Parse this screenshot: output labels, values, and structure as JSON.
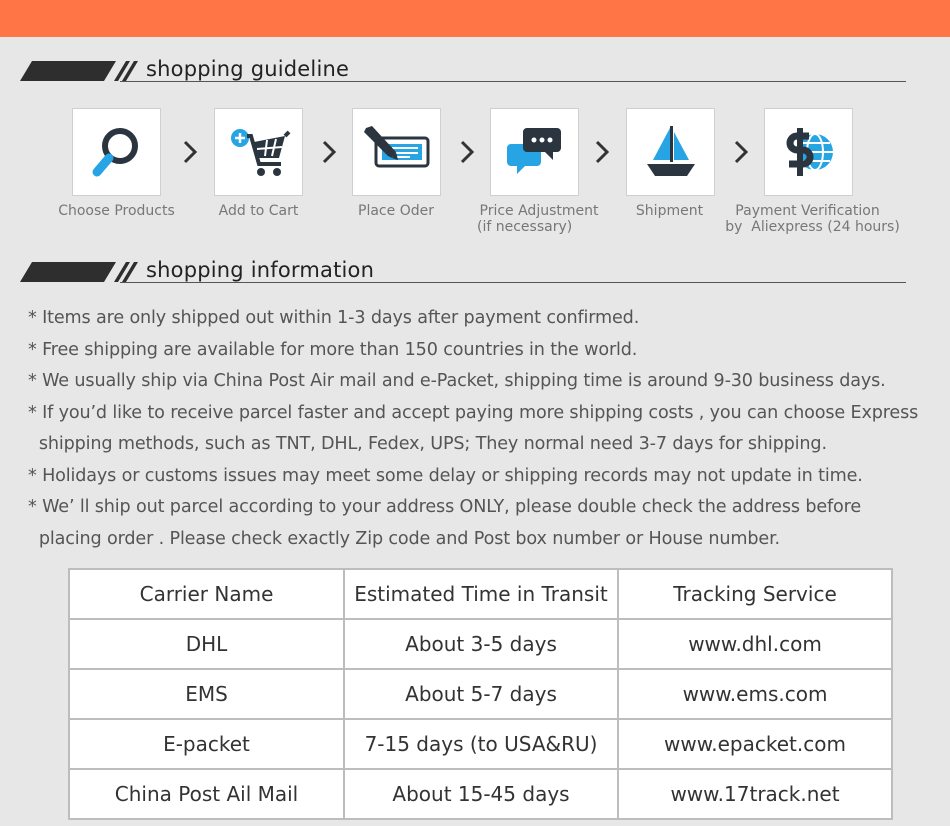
{
  "sections": {
    "guideline_title": "shopping guideline",
    "information_title": "shopping information"
  },
  "steps": [
    {
      "label": "Choose Products",
      "icon": "magnifier-icon"
    },
    {
      "label": "Add to Cart",
      "icon": "shopping-cart-icon"
    },
    {
      "label": "Place Oder",
      "icon": "check-pen-icon"
    },
    {
      "label_line1": "Price Adjustment",
      "label_line2": "(if necessary)",
      "icon": "chat-bubbles-icon"
    },
    {
      "label": "Shipment",
      "icon": "sailboat-icon"
    },
    {
      "label_line1": "Payment Verification",
      "label_line2": "by  Aliexpress (24 hours)",
      "icon": "dollar-globe-icon"
    }
  ],
  "info_items": [
    "* Items are only shipped out within 1-3 days after payment confirmed.",
    "* Free shipping are available for more than 150 countries in the world.",
    "* We usually ship via China Post Air mail and e-Packet, shipping time is around 9-30 business days.",
    "* If you’d like to receive parcel faster and accept paying more shipping costs , you can choose Express",
    "  shipping methods, such as TNT, DHL, Fedex, UPS; They normal need 3-7 days for shipping.",
    "* Holidays or customs issues may meet some delay or shipping records may not update in time.",
    "* We’ ll ship out parcel according to your address ONLY, please double check the address before",
    "  placing order . Please check exactly Zip code and Post box number or House number."
  ],
  "table": {
    "headers": [
      "Carrier Name",
      "Estimated Time in Transit",
      "Tracking Service"
    ],
    "rows": [
      [
        "DHL",
        "About 3-5 days",
        "www.dhl.com"
      ],
      [
        "EMS",
        "About 5-7 days",
        "www.ems.com"
      ],
      [
        "E-packet",
        "7-15 days (to USA&RU)",
        "www.epacket.com"
      ],
      [
        "China Post Ail Mail",
        "About 15-45 days",
        "www.17track.net"
      ]
    ]
  },
  "colors": {
    "top_bar": "#ff7546",
    "background": "#e7e7e7",
    "icon_dark": "#2b3540",
    "icon_blue": "#27a4e3"
  }
}
